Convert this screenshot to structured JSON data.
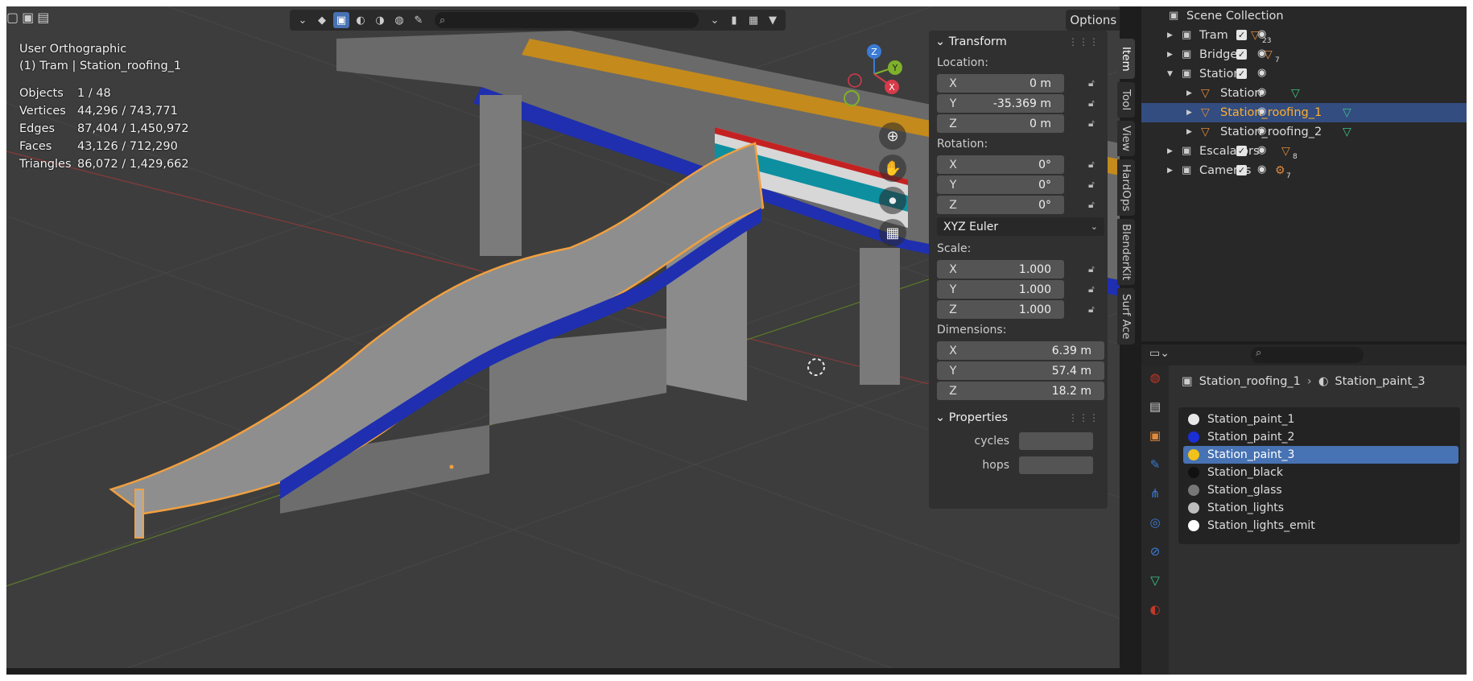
{
  "viewport": {
    "options_label": "Options",
    "view_name": "User Orthographic",
    "context": "(1) Tram | Station_roofing_1",
    "stats": [
      {
        "label": "Objects",
        "value": "1 / 48"
      },
      {
        "label": "Vertices",
        "value": "44,296 / 743,771"
      },
      {
        "label": "Edges",
        "value": "87,404 / 1,450,972"
      },
      {
        "label": "Faces",
        "value": "43,126 / 712,290"
      },
      {
        "label": "Triangles",
        "value": "86,072 / 1,429,662"
      }
    ],
    "gizmo": {
      "z": "Z",
      "y": "Y",
      "x": "X"
    }
  },
  "npanel": {
    "transform_title": "Transform",
    "location_label": "Location:",
    "location": [
      {
        "axis": "X",
        "value": "0 m"
      },
      {
        "axis": "Y",
        "value": "-35.369 m"
      },
      {
        "axis": "Z",
        "value": "0 m"
      }
    ],
    "rotation_label": "Rotation:",
    "rotation": [
      {
        "axis": "X",
        "value": "0°"
      },
      {
        "axis": "Y",
        "value": "0°"
      },
      {
        "axis": "Z",
        "value": "0°"
      }
    ],
    "rotation_mode": "XYZ Euler",
    "scale_label": "Scale:",
    "scale": [
      {
        "axis": "X",
        "value": "1.000"
      },
      {
        "axis": "Y",
        "value": "1.000"
      },
      {
        "axis": "Z",
        "value": "1.000"
      }
    ],
    "dimensions_label": "Dimensions:",
    "dimensions": [
      {
        "axis": "X",
        "value": "6.39 m"
      },
      {
        "axis": "Y",
        "value": "57.4 m"
      },
      {
        "axis": "Z",
        "value": "18.2 m"
      }
    ],
    "properties_title": "Properties",
    "props": [
      {
        "label": "cycles"
      },
      {
        "label": "hops"
      }
    ],
    "tabs": [
      "Item",
      "Tool",
      "View",
      "HardOps",
      "BlenderKit",
      "Surf Ace"
    ]
  },
  "outliner": {
    "root": "Scene Collection",
    "items": [
      {
        "name": "Tram",
        "count": "23"
      },
      {
        "name": "Bridge",
        "count": "7"
      },
      {
        "name": "Station",
        "count": ""
      },
      {
        "name": "Station",
        "count": ""
      },
      {
        "name": "Station_roofing_1",
        "count": ""
      },
      {
        "name": "Station_roofing_2",
        "count": ""
      },
      {
        "name": "Escalators",
        "count": "8"
      },
      {
        "name": "Cameras",
        "count": "7"
      }
    ]
  },
  "properties": {
    "object": "Station_roofing_1",
    "material": "Station_paint_3",
    "materials": [
      {
        "name": "Station_paint_1",
        "color": "#e8e8e8"
      },
      {
        "name": "Station_paint_2",
        "color": "#1a2fd6"
      },
      {
        "name": "Station_paint_3",
        "color": "#f2c21a"
      },
      {
        "name": "Station_black",
        "color": "#111111"
      },
      {
        "name": "Station_glass",
        "color": "#777777"
      },
      {
        "name": "Station_lights",
        "color": "#bdbdbd"
      },
      {
        "name": "Station_lights_emit",
        "color": "#ffffff"
      }
    ]
  },
  "colors": {
    "selection": "#4772b3",
    "active_object": "#ffaf29",
    "outline_selected": "#334d80"
  }
}
